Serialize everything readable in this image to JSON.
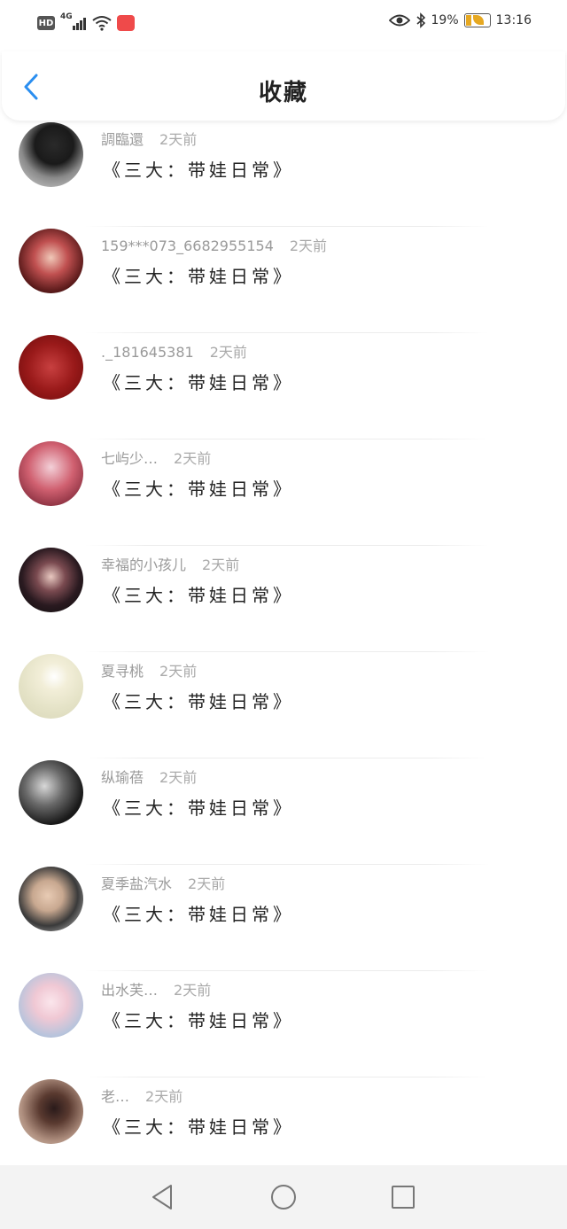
{
  "status_bar": {
    "hd": "HD",
    "network": "4G",
    "battery_percent": "19%",
    "time": "13:16"
  },
  "header": {
    "title": "收藏"
  },
  "items": [
    {
      "user": "調臨還",
      "time": "2天前",
      "title": "《三大：带娃日常》"
    },
    {
      "user": "159***073_6682955154",
      "time": "2天前",
      "title": "《三大：带娃日常》"
    },
    {
      "user": "._181645381",
      "time": "2天前",
      "title": "《三大：带娃日常》"
    },
    {
      "user": "七屿少…",
      "time": "2天前",
      "title": "《三大：带娃日常》"
    },
    {
      "user": "幸福的小孩儿",
      "time": "2天前",
      "title": "《三大：带娃日常》"
    },
    {
      "user": "夏寻桃",
      "time": "2天前",
      "title": "《三大：带娃日常》"
    },
    {
      "user": "纵瑜蓓",
      "time": "2天前",
      "title": "《三大：带娃日常》"
    },
    {
      "user": "夏季盐汽水",
      "time": "2天前",
      "title": "《三大：带娃日常》"
    },
    {
      "user": "出水芙…",
      "time": "2天前",
      "title": "《三大：带娃日常》"
    },
    {
      "user": "老…",
      "time": "2天前",
      "title": "《三大：带娃日常》"
    }
  ],
  "colors": {
    "accent": "#2a8ef0",
    "meta_text": "#9a9a9a",
    "title_text": "#222222",
    "nav_bg": "#f3f3f3"
  },
  "icons": {
    "back": "chevron-left-icon",
    "eye": "eye-icon",
    "bluetooth": "bluetooth-icon",
    "nav_back": "triangle-back-icon",
    "nav_home": "circle-home-icon",
    "nav_recent": "square-recent-icon"
  }
}
